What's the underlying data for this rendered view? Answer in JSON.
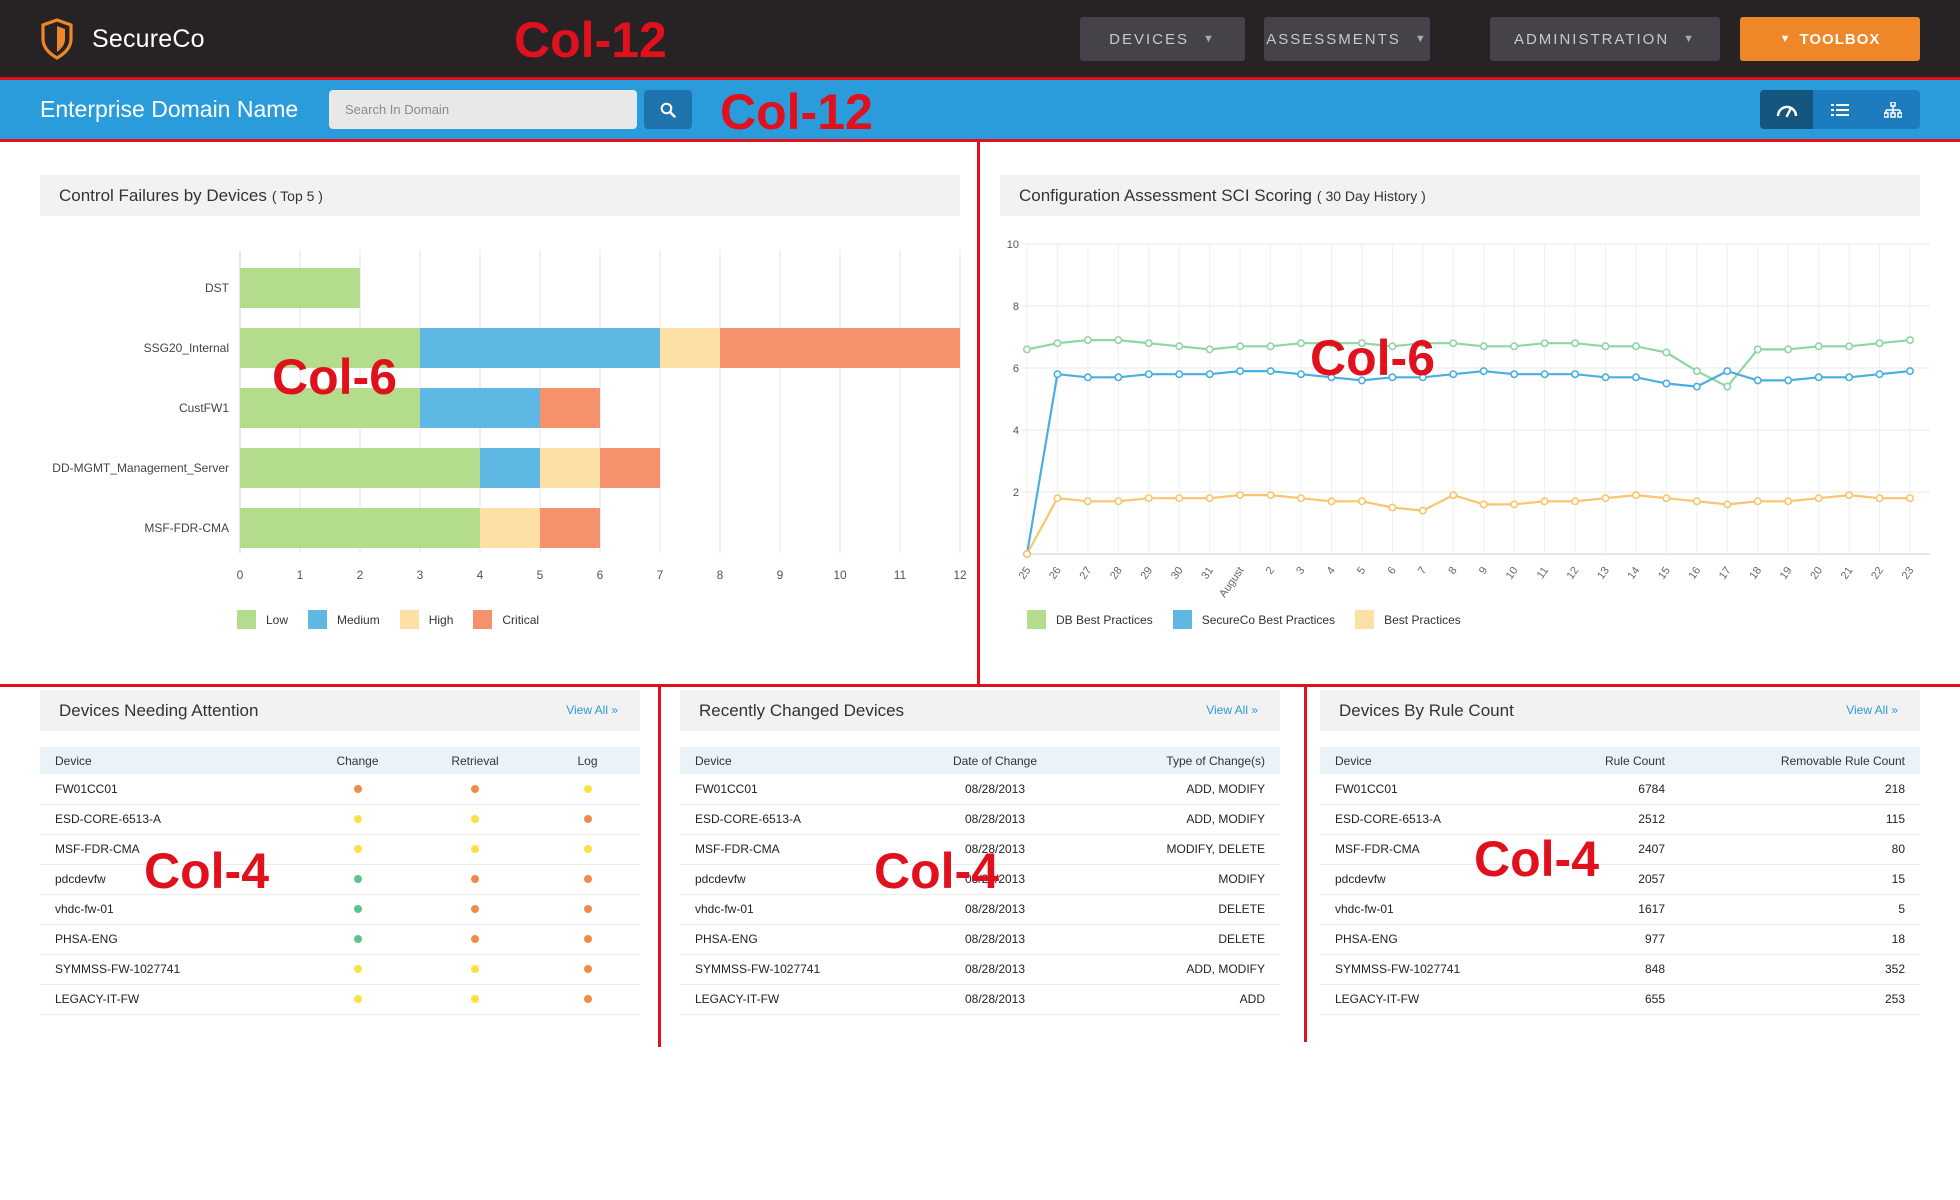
{
  "app": {
    "name": "SecureCo"
  },
  "nav": {
    "items": [
      {
        "label": "DEVICES"
      },
      {
        "label": "ASSESSMENTS"
      },
      {
        "label": "ADMINISTRATION"
      }
    ],
    "toolbox_label": "TOOLBOX"
  },
  "domain_bar": {
    "title": "Enterprise Domain Name",
    "search_placeholder": "Search In Domain",
    "search_value": "",
    "view_modes": [
      "dashboard-icon",
      "list-icon",
      "hierarchy-icon"
    ],
    "active_view": "dashboard-icon"
  },
  "annotations": {
    "col12": "Col-12",
    "col6": "Col-6",
    "col4": "Col-4"
  },
  "failures_panel": {
    "title": "Control Failures by Devices",
    "subtitle": "( Top 5 )"
  },
  "scoring_panel": {
    "title": "Configuration Assessment SCI Scoring",
    "subtitle": "( 30 Day History )"
  },
  "chart_data": [
    {
      "type": "bar",
      "orientation": "horizontal",
      "stacked": true,
      "categories": [
        "DST",
        "SSG20_Internal",
        "CustFW1",
        "DD-MGMT_Management_Server",
        "MSF-FDR-CMA"
      ],
      "series": [
        {
          "name": "Low",
          "color": "#b3dc8c",
          "values": [
            2,
            3,
            3,
            4,
            4
          ]
        },
        {
          "name": "Medium",
          "color": "#5fb7e4",
          "values": [
            0,
            4,
            2,
            1,
            0
          ]
        },
        {
          "name": "High",
          "color": "#fde0a6",
          "values": [
            0,
            1,
            0,
            1,
            1
          ]
        },
        {
          "name": "Critical",
          "color": "#f5916b",
          "values": [
            0,
            4,
            1,
            1,
            1
          ]
        }
      ],
      "xlim": [
        0,
        12
      ],
      "xticks": [
        0,
        1,
        2,
        3,
        4,
        5,
        6,
        7,
        8,
        9,
        10,
        11,
        12
      ],
      "grid": true,
      "legend": "bottom-left"
    },
    {
      "type": "line",
      "x": [
        "25",
        "26",
        "27",
        "28",
        "29",
        "30",
        "31",
        "August",
        "2",
        "3",
        "4",
        "5",
        "6",
        "7",
        "8",
        "9",
        "10",
        "11",
        "12",
        "13",
        "14",
        "15",
        "16",
        "17",
        "18",
        "19",
        "20",
        "21",
        "22",
        "23"
      ],
      "ylim": [
        0,
        10
      ],
      "yticks": [
        2,
        4,
        6,
        8,
        10
      ],
      "series": [
        {
          "name": "DB Best Practices",
          "color": "#8fd5a6",
          "values": [
            6.6,
            6.8,
            6.9,
            6.9,
            6.8,
            6.7,
            6.6,
            6.7,
            6.7,
            6.8,
            6.8,
            6.8,
            6.7,
            6.8,
            6.8,
            6.7,
            6.7,
            6.8,
            6.8,
            6.7,
            6.7,
            6.5,
            5.9,
            5.4,
            6.6,
            6.6,
            6.7,
            6.7,
            6.8,
            6.9
          ]
        },
        {
          "name": "SecureCo Best Practices",
          "color": "#4aaee3",
          "values": [
            0,
            5.8,
            5.7,
            5.7,
            5.8,
            5.8,
            5.8,
            5.9,
            5.9,
            5.8,
            5.7,
            5.6,
            5.7,
            5.7,
            5.8,
            5.9,
            5.8,
            5.8,
            5.8,
            5.7,
            5.7,
            5.5,
            5.4,
            5.9,
            5.6,
            5.6,
            5.7,
            5.7,
            5.8,
            5.9
          ]
        },
        {
          "name": "Best Practices",
          "color": "#fbc46e",
          "values": [
            0,
            1.8,
            1.7,
            1.7,
            1.8,
            1.8,
            1.8,
            1.9,
            1.9,
            1.8,
            1.7,
            1.7,
            1.5,
            1.4,
            1.9,
            1.6,
            1.6,
            1.7,
            1.7,
            1.8,
            1.9,
            1.8,
            1.7,
            1.6,
            1.7,
            1.7,
            1.8,
            1.9,
            1.8,
            1.8
          ]
        }
      ],
      "legend_swatches": [
        "#b3dc8c",
        "#5fb7e4",
        "#fde0a6"
      ],
      "grid": true,
      "legend": "bottom-left"
    }
  ],
  "attention": {
    "title": "Devices Needing Attention",
    "view_all": "View All »",
    "columns": [
      "Device",
      "Change",
      "Retrieval",
      "Log"
    ],
    "rows": [
      {
        "device": "FW01CC01",
        "status": [
          "#f08a4b",
          "#f08a4b",
          "#fde047"
        ]
      },
      {
        "device": "ESD-CORE-6513-A",
        "status": [
          "#fde047",
          "#fde047",
          "#f08a4b"
        ]
      },
      {
        "device": "MSF-FDR-CMA",
        "status": [
          "#fde047",
          "#fde047",
          "#fde047"
        ]
      },
      {
        "device": "pdcdevfw",
        "status": [
          "#5cc48a",
          "#f08a4b",
          "#f08a4b"
        ]
      },
      {
        "device": "vhdc-fw-01",
        "status": [
          "#5cc48a",
          "#f08a4b",
          "#f08a4b"
        ]
      },
      {
        "device": "PHSA-ENG",
        "status": [
          "#5cc48a",
          "#f08a4b",
          "#f08a4b"
        ]
      },
      {
        "device": "SYMMSS-FW-1027741",
        "status": [
          "#fde047",
          "#fde047",
          "#f08a4b"
        ]
      },
      {
        "device": "LEGACY-IT-FW",
        "status": [
          "#fde047",
          "#fde047",
          "#f08a4b"
        ]
      }
    ]
  },
  "changed": {
    "title": "Recently Changed Devices",
    "view_all": "View All »",
    "columns": [
      "Device",
      "Date of Change",
      "Type of Change(s)"
    ],
    "rows": [
      {
        "device": "FW01CC01",
        "date": "08/28/2013",
        "type": "ADD, MODIFY"
      },
      {
        "device": "ESD-CORE-6513-A",
        "date": "08/28/2013",
        "type": "ADD, MODIFY"
      },
      {
        "device": "MSF-FDR-CMA",
        "date": "08/28/2013",
        "type": "MODIFY, DELETE"
      },
      {
        "device": "pdcdevfw",
        "date": "08/28/2013",
        "type": "MODIFY"
      },
      {
        "device": "vhdc-fw-01",
        "date": "08/28/2013",
        "type": "DELETE"
      },
      {
        "device": "PHSA-ENG",
        "date": "08/28/2013",
        "type": "DELETE"
      },
      {
        "device": "SYMMSS-FW-1027741",
        "date": "08/28/2013",
        "type": "ADD, MODIFY"
      },
      {
        "device": "LEGACY-IT-FW",
        "date": "08/28/2013",
        "type": "ADD"
      }
    ]
  },
  "rulecount": {
    "title": "Devices By Rule Count",
    "view_all": "View All »",
    "columns": [
      "Device",
      "Rule Count",
      "Removable Rule Count"
    ],
    "rows": [
      {
        "device": "FW01CC01",
        "rules": "6784",
        "removable": "218"
      },
      {
        "device": "ESD-CORE-6513-A",
        "rules": "2512",
        "removable": "115"
      },
      {
        "device": "MSF-FDR-CMA",
        "rules": "2407",
        "removable": "80"
      },
      {
        "device": "pdcdevfw",
        "rules": "2057",
        "removable": "15"
      },
      {
        "device": "vhdc-fw-01",
        "rules": "1617",
        "removable": "5"
      },
      {
        "device": "PHSA-ENG",
        "rules": "977",
        "removable": "18"
      },
      {
        "device": "SYMMSS-FW-1027741",
        "rules": "848",
        "removable": "352"
      },
      {
        "device": "LEGACY-IT-FW",
        "rules": "655",
        "removable": "253"
      }
    ]
  }
}
